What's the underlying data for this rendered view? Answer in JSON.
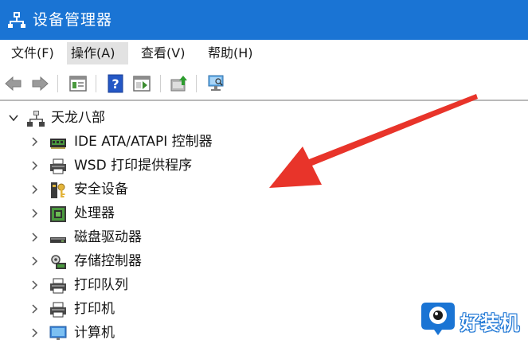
{
  "window": {
    "title": "设备管理器",
    "titlebar_color": "#1a74d4"
  },
  "menu": {
    "items": [
      {
        "label": "文件(F)"
      },
      {
        "label": "操作(A)"
      },
      {
        "label": "查看(V)"
      },
      {
        "label": "帮助(H)"
      }
    ],
    "active": "操作(A)"
  },
  "toolbar": {
    "buttons": [
      "back-arrow-icon",
      "forward-arrow-icon",
      "properties-panel-icon",
      "help-icon",
      "show-hide-tree-icon",
      "update-driver-icon",
      "scan-hardware-icon"
    ]
  },
  "tree": {
    "root": {
      "label": "天龙八部",
      "icon": "computer-network-icon",
      "expanded": true
    },
    "children": [
      {
        "label": "IDE ATA/ATAPI 控制器",
        "icon": "ide-controller-icon"
      },
      {
        "label": "WSD 打印提供程序",
        "icon": "printer-icon"
      },
      {
        "label": "安全设备",
        "icon": "security-key-icon"
      },
      {
        "label": "处理器",
        "icon": "processor-icon"
      },
      {
        "label": "磁盘驱动器",
        "icon": "disk-drive-icon"
      },
      {
        "label": "存储控制器",
        "icon": "storage-controller-icon"
      },
      {
        "label": "打印队列",
        "icon": "printer-icon"
      },
      {
        "label": "打印机",
        "icon": "printer-icon"
      },
      {
        "label": "计算机",
        "icon": "monitor-icon"
      }
    ]
  },
  "annotation": {
    "arrow_color": "#e8342a"
  },
  "watermark": {
    "text": "好装机",
    "color": "#1a74d4"
  }
}
